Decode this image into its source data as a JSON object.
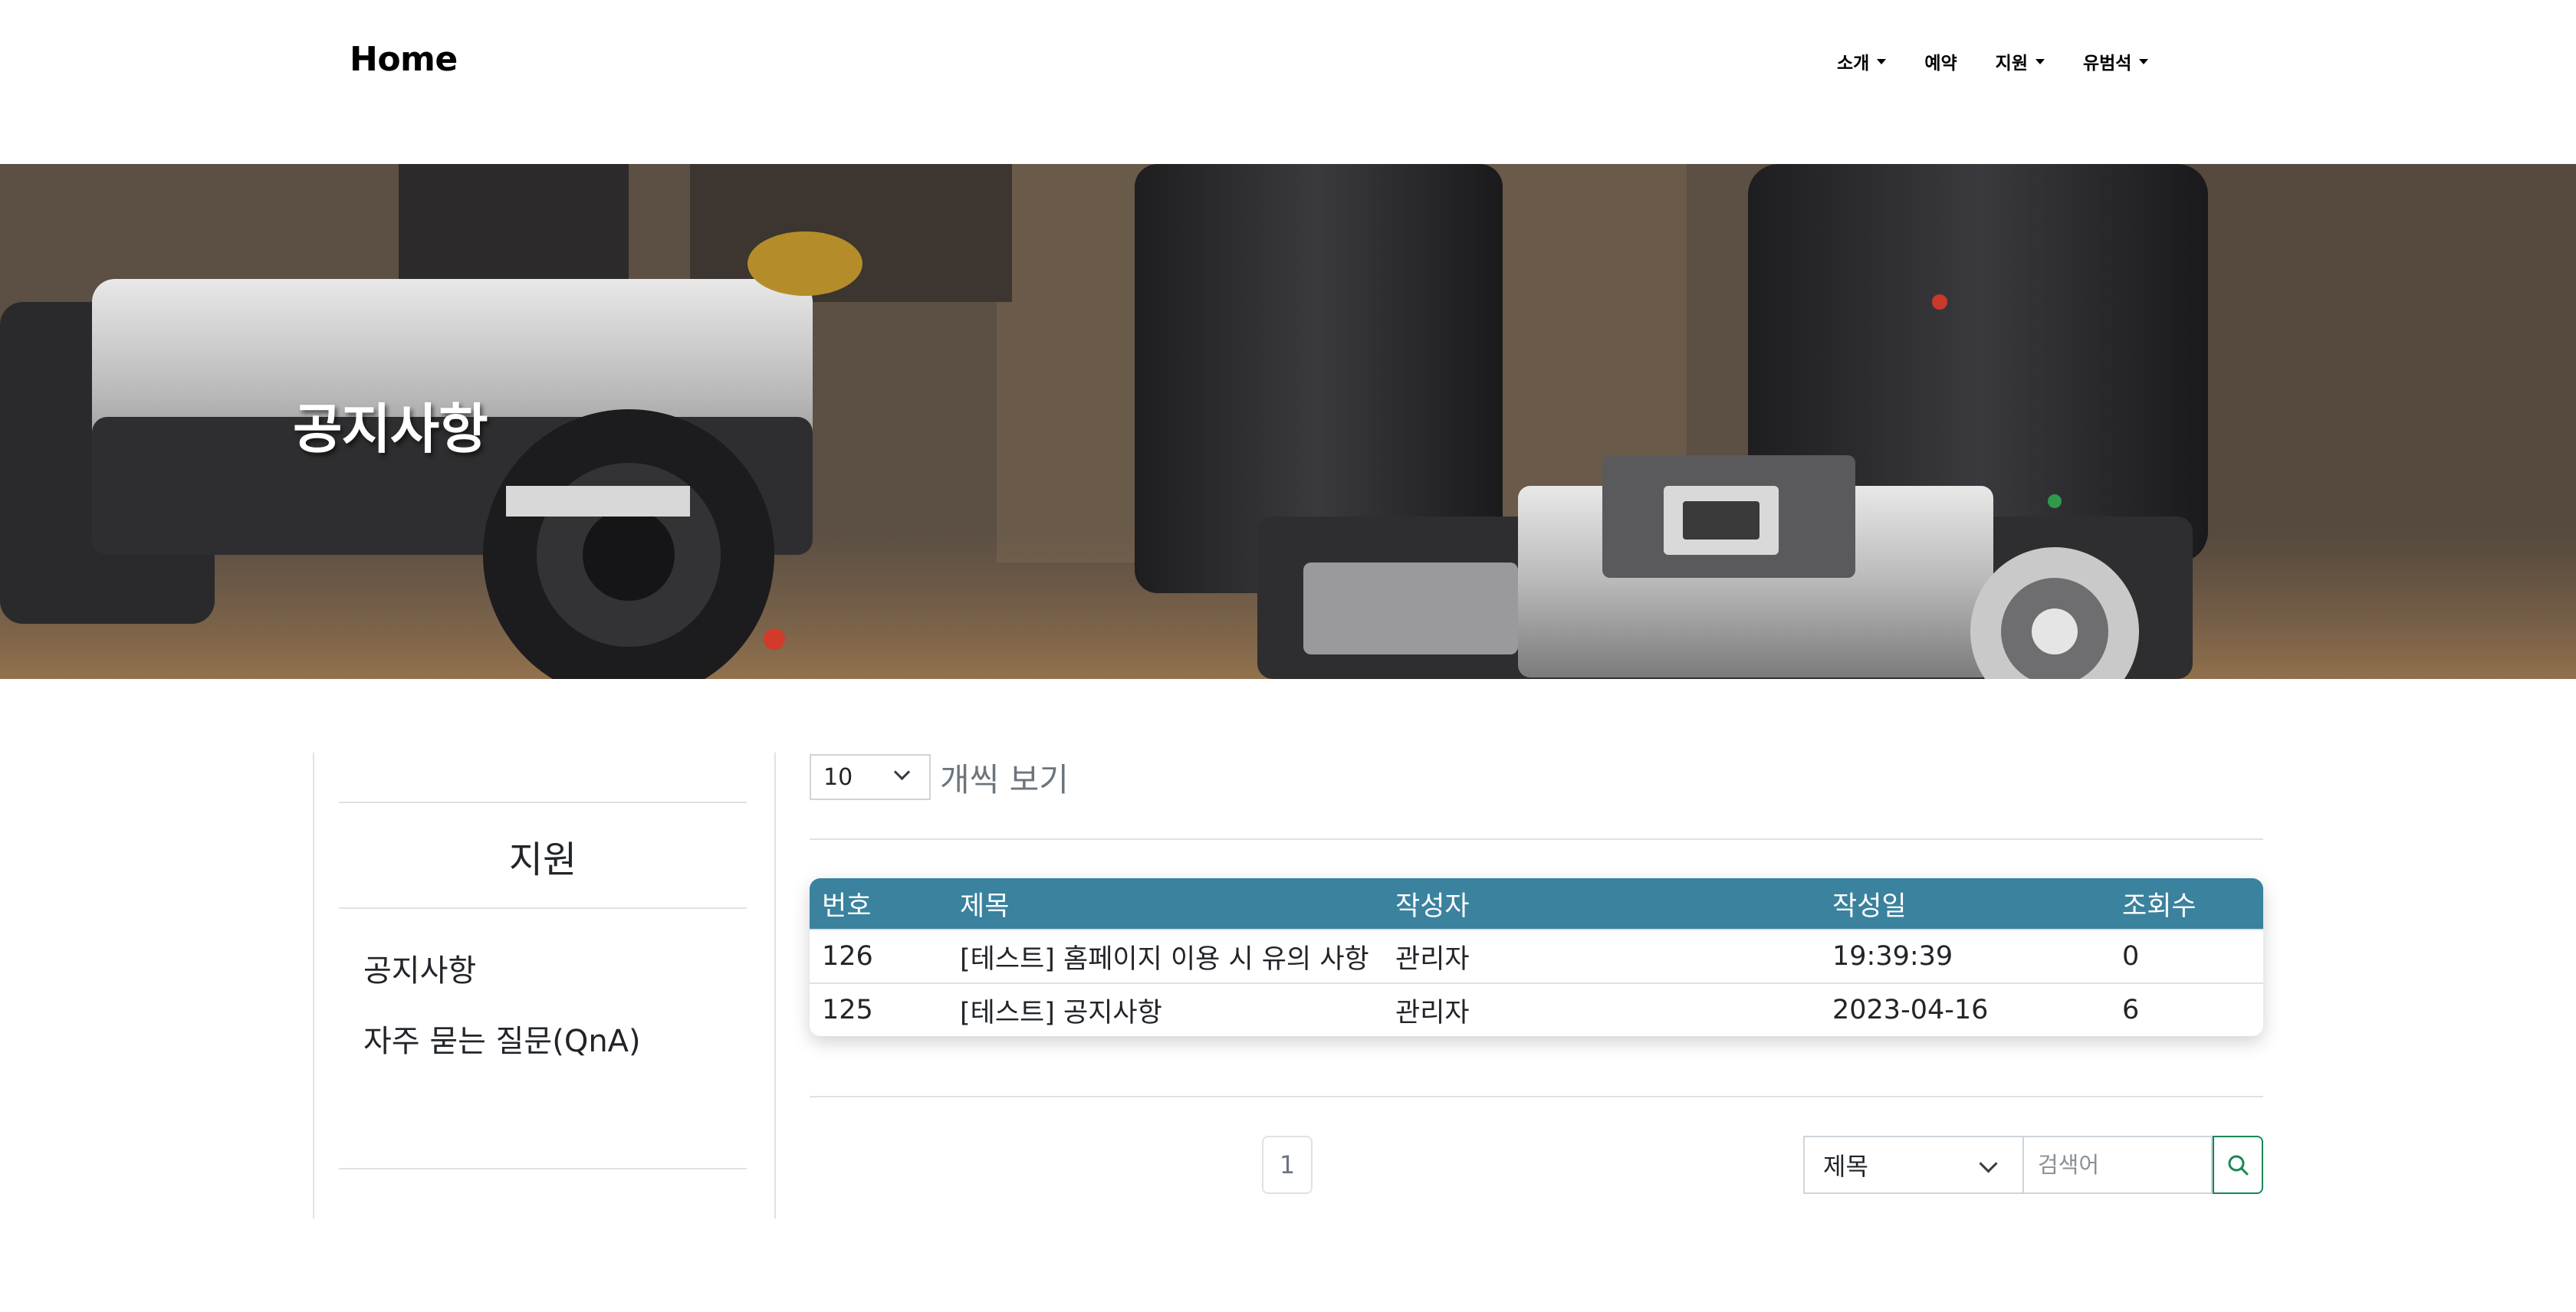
{
  "nav": {
    "brand": "Home",
    "items": [
      {
        "label": "소개",
        "dropdown": true
      },
      {
        "label": "예약",
        "dropdown": false
      },
      {
        "label": "지원",
        "dropdown": true
      },
      {
        "label": "유범석",
        "dropdown": true
      }
    ]
  },
  "hero": {
    "title": "공지사항"
  },
  "sidebar": {
    "title": "지원",
    "links": [
      "공지사항",
      "자주 묻는 질문(QnA)"
    ]
  },
  "list_controls": {
    "page_size": "10",
    "page_size_label": "개씩 보기"
  },
  "board": {
    "columns": [
      "번호",
      "제목",
      "작성자",
      "작성일",
      "조회수"
    ],
    "rows": [
      [
        "126",
        "[테스트] 홈페이지 이용 시 유의 사항",
        "관리자",
        "19:39:39",
        "0"
      ],
      [
        "125",
        "[테스트] 공지사항",
        "관리자",
        "2023-04-16",
        "6"
      ]
    ]
  },
  "pagination": {
    "current_page": "1"
  },
  "search": {
    "field": "제목",
    "placeholder": "검색어"
  },
  "colors": {
    "table_header": "#3a829e",
    "search_button_border": "#198754"
  }
}
